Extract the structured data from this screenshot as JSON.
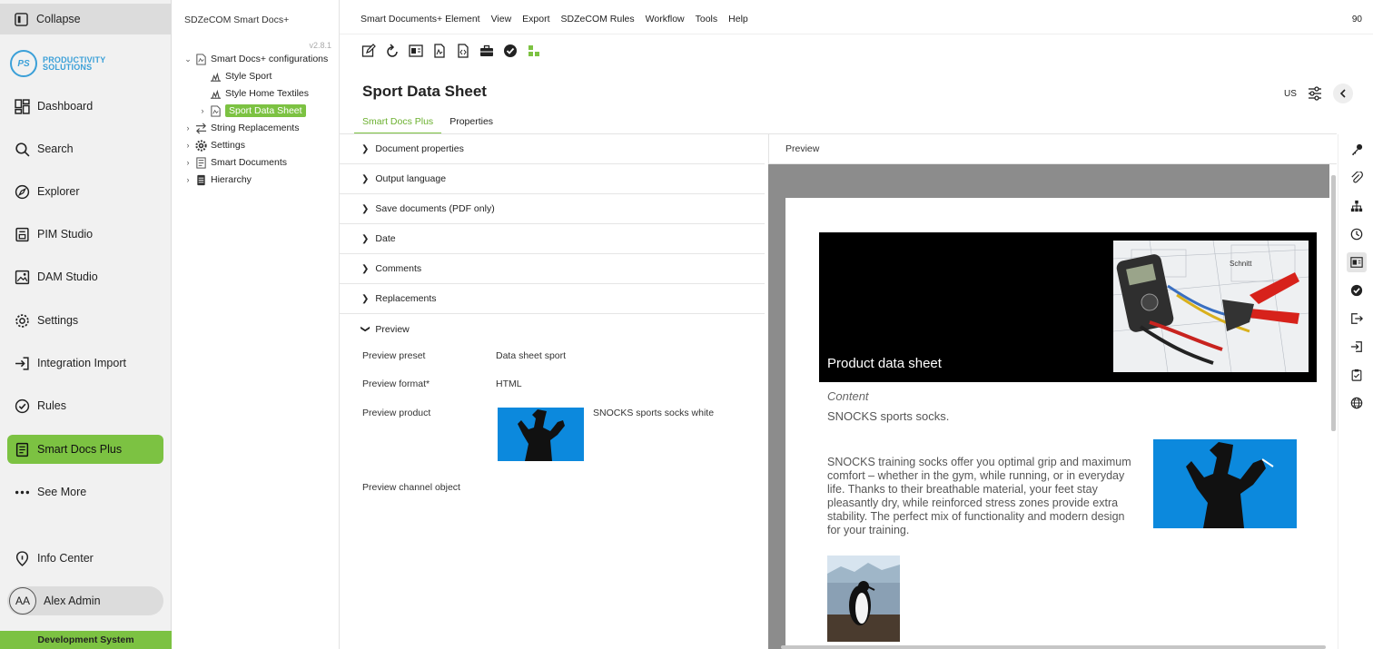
{
  "nav": {
    "collapse_label": "Collapse",
    "logo_mark": "PS",
    "logo_line1": "PRODUCTIVITY",
    "logo_line2": "SOLUTIONS",
    "items": [
      {
        "label": "Dashboard",
        "icon": "dashboard-icon"
      },
      {
        "label": "Search",
        "icon": "search-icon"
      },
      {
        "label": "Explorer",
        "icon": "explorer-icon"
      },
      {
        "label": "PIM Studio",
        "icon": "pim-studio-icon"
      },
      {
        "label": "DAM Studio",
        "icon": "dam-studio-icon"
      },
      {
        "label": "Settings",
        "icon": "gear-icon"
      },
      {
        "label": "Integration Import",
        "icon": "import-icon"
      },
      {
        "label": "Rules",
        "icon": "check-circle-icon"
      },
      {
        "label": "Smart Docs Plus",
        "icon": "document-icon",
        "active": true
      },
      {
        "label": "See More",
        "icon": "more-icon"
      },
      {
        "label": "Info Center",
        "icon": "info-icon"
      }
    ],
    "user_initials": "AA",
    "user_name": "Alex Admin",
    "environment": "Development System",
    "accent": "#7cc242"
  },
  "tree": {
    "title": "SDZeCOM Smart Docs+",
    "version": "v2.8.1",
    "items": [
      {
        "label": "Smart Docs+ configurations",
        "expanded": true
      },
      {
        "label": "Style Sport"
      },
      {
        "label": "Style Home Textiles"
      },
      {
        "label": "Sport Data Sheet",
        "selected": true
      },
      {
        "label": "String Replacements"
      },
      {
        "label": "Settings"
      },
      {
        "label": "Smart Documents"
      },
      {
        "label": "Hierarchy"
      }
    ]
  },
  "menu": {
    "items": [
      "Smart Documents+ Element",
      "View",
      "Export",
      "SDZeCOM Rules",
      "Workflow",
      "Tools",
      "Help"
    ],
    "right_number": "90"
  },
  "toolbar": {
    "icons": [
      "edit-icon",
      "reload-icon",
      "preview-icon",
      "pdf-icon",
      "html-icon",
      "briefcase-icon",
      "check-icon",
      "workflow-icon"
    ]
  },
  "header": {
    "title": "Sport Data Sheet",
    "locale": "US"
  },
  "tabs": [
    {
      "label": "Smart Docs Plus",
      "active": true
    },
    {
      "label": "Properties"
    }
  ],
  "sections": [
    "Document properties",
    "Output language",
    "Save documents (PDF only)",
    "Date",
    "Comments",
    "Replacements",
    "Preview"
  ],
  "preview_props": {
    "preset_label": "Preview preset",
    "preset_value": "Data sheet sport",
    "format_label": "Preview format*",
    "format_value": "HTML",
    "product_label": "Preview product",
    "product_value": "SNOCKS sports socks white",
    "channel_label": "Preview channel object"
  },
  "preview": {
    "header": "Preview",
    "hero_title": "Product data sheet",
    "content_label": "Content",
    "content_sub": "SNOCKS sports socks.",
    "content_body": "SNOCKS training socks offer you optimal grip and maximum comfort – whether in the gym, while running, or in everyday life. Thanks to their breathable material, your feet stay pleasantly dry, while reinforced stress zones provide extra stability. The perfect mix of functionality and modern design for your training.",
    "brand_on_tool": "Schnitt"
  },
  "rail_icons": [
    "key-icon",
    "paperclip-icon",
    "hierarchy-icon",
    "clock-icon",
    "preview-icon",
    "check-circle-icon",
    "export-icon",
    "import-icon",
    "clipboard-icon",
    "globe-icon"
  ]
}
